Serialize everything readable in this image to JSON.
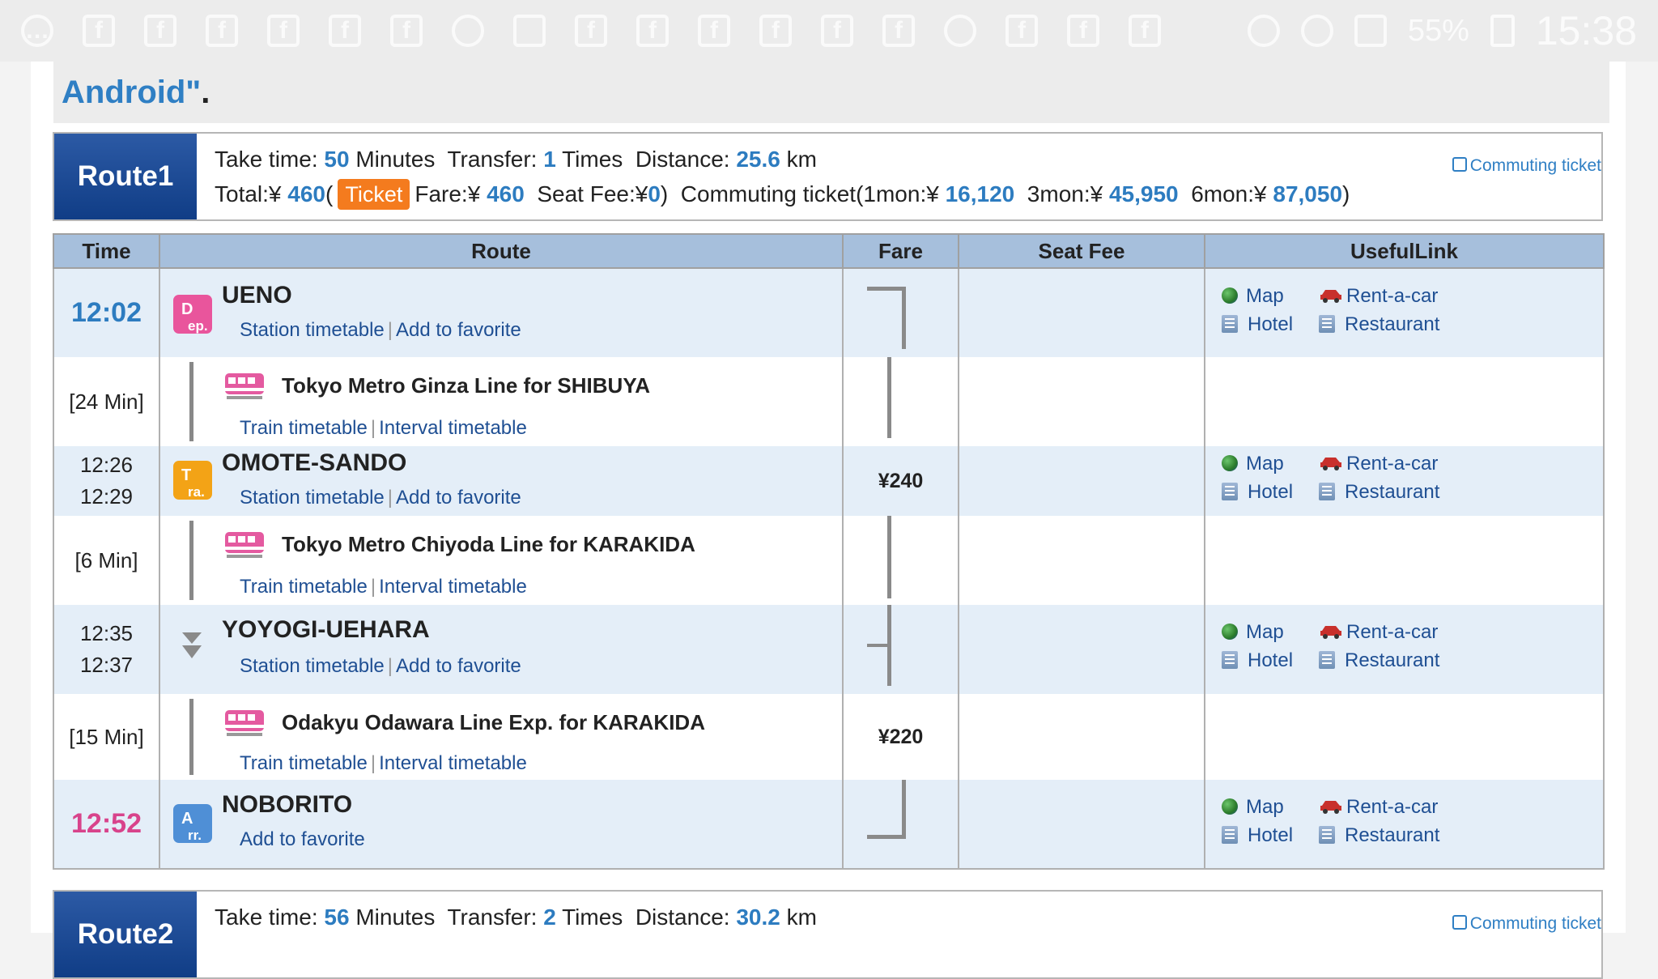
{
  "status_bar": {
    "battery": "55%",
    "clock": "15:38"
  },
  "notice": {
    "text_link": "Android\"",
    "text_end": "."
  },
  "route1": {
    "label": "Route1",
    "take_time_label": "Take time:",
    "take_time": "50",
    "minutes_label": "Minutes",
    "transfer_label": "Transfer:",
    "transfer": "1",
    "times_label": "Times",
    "distance_label": "Distance:",
    "distance": "25.6",
    "km_label": "km",
    "total_label": "Total:¥",
    "total": "460",
    "ticket_badge": "Ticket",
    "fare_label": "Fare:¥",
    "fare": "460",
    "seat_fee_label": "Seat Fee:¥",
    "seat_fee": "0",
    "commuting_label": "Commuting ticket(1mon:¥",
    "mon1": "16,120",
    "mon3_label": "3mon:¥",
    "mon3": "45,950",
    "mon6_label": "6mon:¥",
    "mon6": "87,050",
    "commuting_link": "Commuting ticket"
  },
  "table": {
    "headers": {
      "time": "Time",
      "route": "Route",
      "fare": "Fare",
      "seat_fee": "Seat Fee",
      "useful": "UsefulLink"
    },
    "rows": {
      "ueno": {
        "time": "12:02",
        "badge": "D",
        "badge2": "ep.",
        "name": "UENO",
        "link1": "Station timetable",
        "link2": "Add to favorite"
      },
      "ginza": {
        "duration": "[24 Min]",
        "name": "Tokyo Metro Ginza Line  for SHIBUYA",
        "link1": "Train timetable",
        "link2": "Interval timetable"
      },
      "omote": {
        "arr": "12:26",
        "dep": "12:29",
        "badge": "T",
        "badge2": "ra.",
        "name": "OMOTE-SANDO",
        "link1": "Station timetable",
        "link2": "Add to favorite",
        "fare": "¥240"
      },
      "chiyoda": {
        "duration": "[6 Min]",
        "name": "Tokyo Metro Chiyoda Line  for KARAKIDA",
        "link1": "Train timetable",
        "link2": "Interval timetable"
      },
      "yoyogi": {
        "arr": "12:35",
        "dep": "12:37",
        "name": "YOYOGI-UEHARA",
        "link1": "Station timetable",
        "link2": "Add to favorite"
      },
      "odakyu": {
        "duration": "[15 Min]",
        "name": "Odakyu Odawara Line Exp.  for KARAKIDA",
        "link1": "Train timetable",
        "link2": "Interval timetable",
        "fare": "¥220"
      },
      "noborito": {
        "time": "12:52",
        "badge": "A",
        "badge2": "rr.",
        "name": "NOBORITO",
        "link1": "Add to favorite"
      }
    },
    "useful": {
      "map": "Map",
      "rent": "Rent-a-car",
      "hotel": "Hotel",
      "restaurant": "Restaurant"
    }
  },
  "route2": {
    "label": "Route2",
    "take_time_label": "Take time:",
    "take_time": "56",
    "minutes_label": "Minutes",
    "transfer_label": "Transfer:",
    "transfer": "2",
    "times_label": "Times",
    "distance_label": "Distance:",
    "distance": "30.2",
    "km_label": "km",
    "commuting_link": "Commuting ticket"
  },
  "colors": {
    "accent_blue": "#2d7cc0",
    "arrival_pink": "#d8438b",
    "ticket_orange": "#f47b1e",
    "header_blue": "#a6bfdc",
    "station_row": "#e4eef8"
  }
}
